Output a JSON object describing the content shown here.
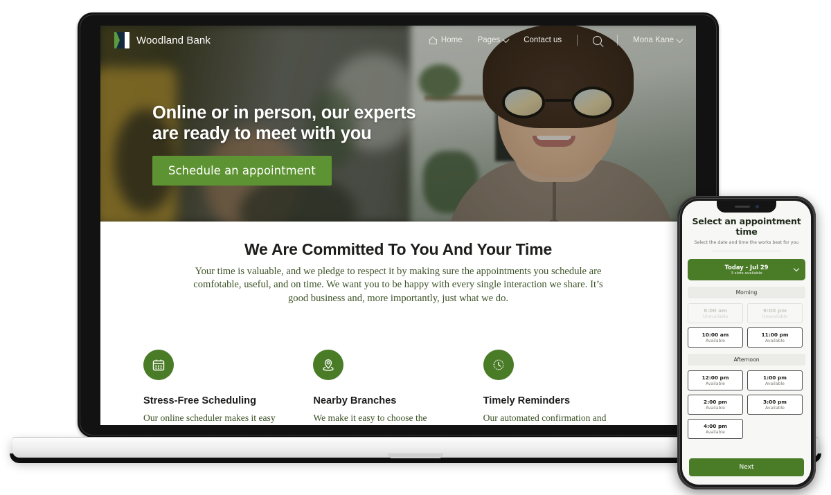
{
  "site": {
    "brand": "Woodland Bank",
    "nav": [
      {
        "label": "Home",
        "icon": "home-icon",
        "chevron": false
      },
      {
        "label": "Pages",
        "icon": "",
        "chevron": true
      },
      {
        "label": "Contact us",
        "icon": "",
        "chevron": false
      }
    ],
    "search_icon": "search-icon",
    "account": {
      "label": "Mona Kane",
      "chevron": true
    }
  },
  "hero": {
    "heading_line1": "Online or in person, our experts",
    "heading_line2": "are ready to meet with you",
    "cta_label": "Schedule an appointment"
  },
  "commitment": {
    "title": "We Are Committed To You And Your Time",
    "body": "Your time is valuable, and we pledge to respect it by making sure the appointments you schedule are comfotable, useful, and on time. We want you to be happy with every single interaction we share. It’s good business and, more importantly, just what we do."
  },
  "features": [
    {
      "icon": "calendar-icon",
      "title": "Stress-Free Scheduling",
      "body": "Our online scheduler makes it easy to get the meeting time"
    },
    {
      "icon": "map-pin-icon",
      "title": "Nearby Branches",
      "body": "We make it easy to choose the location to meet that is"
    },
    {
      "icon": "clock-icon",
      "title": "Timely Reminders",
      "body": "Our automated confirmation and reminder messages helps"
    }
  ],
  "phone": {
    "title": "Select an appointment time",
    "subtitle": "Select the date and time the works best for you",
    "date_selector": {
      "label": "Today - Jul 29",
      "sub": "3 slots available",
      "chevron": true
    },
    "sections": [
      {
        "label": "Morning",
        "slots": [
          {
            "time": "8:00 am",
            "status": "Unavailable",
            "available": false
          },
          {
            "time": "9:00 pm",
            "status": "Unavailable",
            "available": false
          },
          {
            "time": "10:00 am",
            "status": "Available",
            "available": true
          },
          {
            "time": "11:00 pm",
            "status": "Available",
            "available": true
          }
        ]
      },
      {
        "label": "Afternoon",
        "slots": [
          {
            "time": "12:00 pm",
            "status": "Available",
            "available": true
          },
          {
            "time": "1:00 pm",
            "status": "Available",
            "available": true
          },
          {
            "time": "2:00 pm",
            "status": "Available",
            "available": true
          },
          {
            "time": "3:00 pm",
            "status": "Available",
            "available": true
          },
          {
            "time": "4:00 pm",
            "status": "Available",
            "available": true
          }
        ]
      }
    ],
    "next_label": "Next"
  },
  "colors": {
    "brand_green": "#4a7c28",
    "cta_green": "#5d9332",
    "body_green": "#3c5227",
    "logo_navy": "#13293d",
    "logo_green": "#5b9b3e"
  }
}
